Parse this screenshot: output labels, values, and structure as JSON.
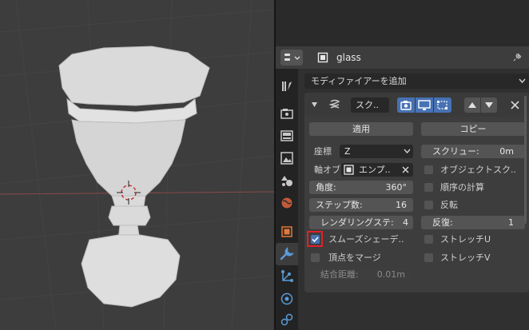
{
  "header": {
    "object_name": "glass"
  },
  "add_modifier": {
    "label": "モディファイアーを追加"
  },
  "modifier": {
    "name": "スク..",
    "apply_label": "適用",
    "copy_label": "コピー",
    "axis_label": "座標",
    "axis_value": "Z",
    "axis_object_label": "軸オブ",
    "axis_object_value": "エンプ..",
    "angle_label": "角度:",
    "angle_value": "360°",
    "steps_label": "ステップ数:",
    "steps_value": "16",
    "render_steps_label": "レンダリングステ:",
    "render_steps_value": "4",
    "smooth_label": "スムーズシェーデ..",
    "merge_label": "頂点をマージ",
    "merge_dist_label": "結合距離:",
    "merge_dist_value": "0.01m",
    "screw_label": "スクリュー:",
    "screw_value": "0m",
    "object_screw_label": "オブジェクトスク..",
    "calc_order_label": "順序の計算",
    "flip_label": "反転",
    "iterations_label": "反復:",
    "iterations_value": "1",
    "stretch_u_label": "ストレッチU",
    "stretch_v_label": "ストレッチV",
    "smooth_checked": true,
    "highlight_color": "#e0212a"
  },
  "sidebar_tabs": [
    "tool-icon",
    "render-icon",
    "output-icon",
    "view-layer-icon",
    "scene-icon",
    "world-icon",
    "object-icon",
    "modifier-icon",
    "particles-icon",
    "physics-icon",
    "constraints-icon"
  ]
}
